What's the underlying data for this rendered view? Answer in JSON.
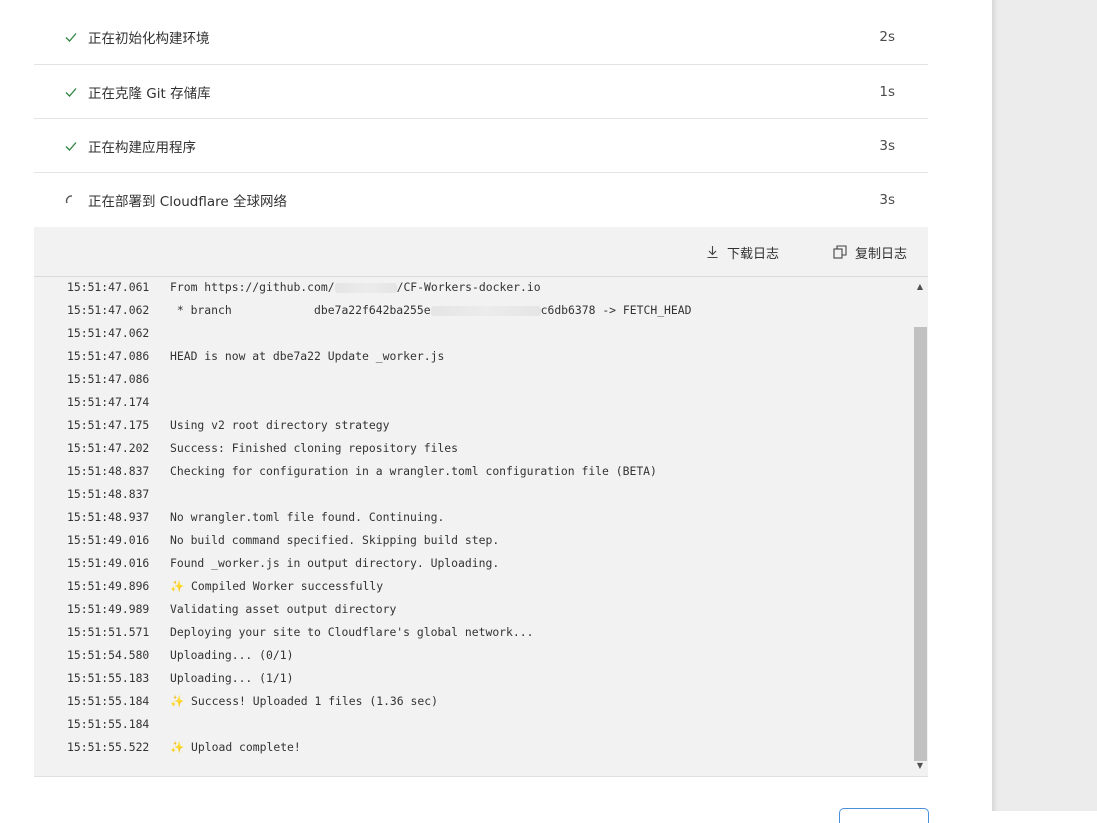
{
  "steps": [
    {
      "label": "正在初始化构建环境",
      "duration": "2s",
      "status": "done",
      "icon": "check-icon"
    },
    {
      "label": "正在克隆 Git 存储库",
      "duration": "1s",
      "status": "done",
      "icon": "check-icon"
    },
    {
      "label": "正在构建应用程序",
      "duration": "3s",
      "status": "done",
      "icon": "check-icon"
    },
    {
      "label": "正在部署到 Cloudflare 全球网络",
      "duration": "3s",
      "status": "in-progress",
      "icon": "spinner-icon"
    }
  ],
  "toolbar": {
    "download_label": "下载日志",
    "copy_label": "复制日志"
  },
  "log": [
    {
      "ts": "15:51:47.061",
      "msg_pre": "From https://github.com/",
      "msg_post": "/CF-Workers-docker.io",
      "redacted": true
    },
    {
      "ts": "15:51:47.062",
      "msg_pre": " * branch            dbe7a22f642ba255e",
      "msg_post": "c6db6378 -> FETCH_HEAD",
      "redacted": true
    },
    {
      "ts": "15:51:47.062",
      "msg": ""
    },
    {
      "ts": "15:51:47.086",
      "msg": "HEAD is now at dbe7a22 Update _worker.js"
    },
    {
      "ts": "15:51:47.086",
      "msg": ""
    },
    {
      "ts": "15:51:47.174",
      "msg": ""
    },
    {
      "ts": "15:51:47.175",
      "msg": "Using v2 root directory strategy"
    },
    {
      "ts": "15:51:47.202",
      "msg": "Success: Finished cloning repository files"
    },
    {
      "ts": "15:51:48.837",
      "msg": "Checking for configuration in a wrangler.toml configuration file (BETA)"
    },
    {
      "ts": "15:51:48.837",
      "msg": ""
    },
    {
      "ts": "15:51:48.937",
      "msg": "No wrangler.toml file found. Continuing."
    },
    {
      "ts": "15:51:49.016",
      "msg": "No build command specified. Skipping build step."
    },
    {
      "ts": "15:51:49.016",
      "msg": "Found _worker.js in output directory. Uploading."
    },
    {
      "ts": "15:51:49.896",
      "msg": "Compiled Worker successfully",
      "sparkle": "✨"
    },
    {
      "ts": "15:51:49.989",
      "msg": "Validating asset output directory"
    },
    {
      "ts": "15:51:51.571",
      "msg": "Deploying your site to Cloudflare's global network..."
    },
    {
      "ts": "15:51:54.580",
      "msg": "Uploading... (0/1)"
    },
    {
      "ts": "15:51:55.183",
      "msg": "Uploading... (1/1)"
    },
    {
      "ts": "15:51:55.184",
      "msg": "Success! Uploaded 1 files (1.36 sec)",
      "sparkle": "✨"
    },
    {
      "ts": "15:51:55.184",
      "msg": ""
    },
    {
      "ts": "15:51:55.522",
      "msg": "Upload complete!",
      "sparkle": "✨"
    }
  ],
  "colors": {
    "check": "#2e8540",
    "sparkle": "#f0b400",
    "log_bg": "#f2f2f2"
  }
}
